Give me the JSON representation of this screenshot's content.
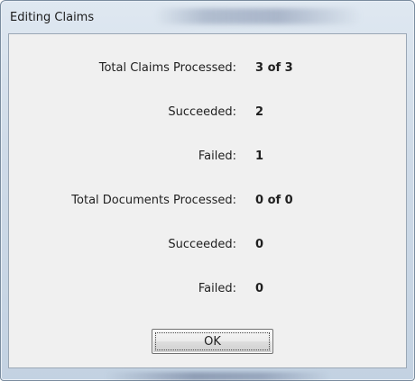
{
  "window": {
    "title": "Editing Claims"
  },
  "stats": {
    "total_claims_label": "Total Claims Processed:",
    "total_claims_value": "3 of 3",
    "claims_succeeded_label": "Succeeded:",
    "claims_succeeded_value": "2",
    "claims_failed_label": "Failed:",
    "claims_failed_value": "1",
    "total_documents_label": "Total Documents Processed:",
    "total_documents_value": "0 of 0",
    "documents_succeeded_label": "Succeeded:",
    "documents_succeeded_value": "0",
    "documents_failed_label": "Failed:",
    "documents_failed_value": "0"
  },
  "buttons": {
    "ok_label": "OK"
  }
}
